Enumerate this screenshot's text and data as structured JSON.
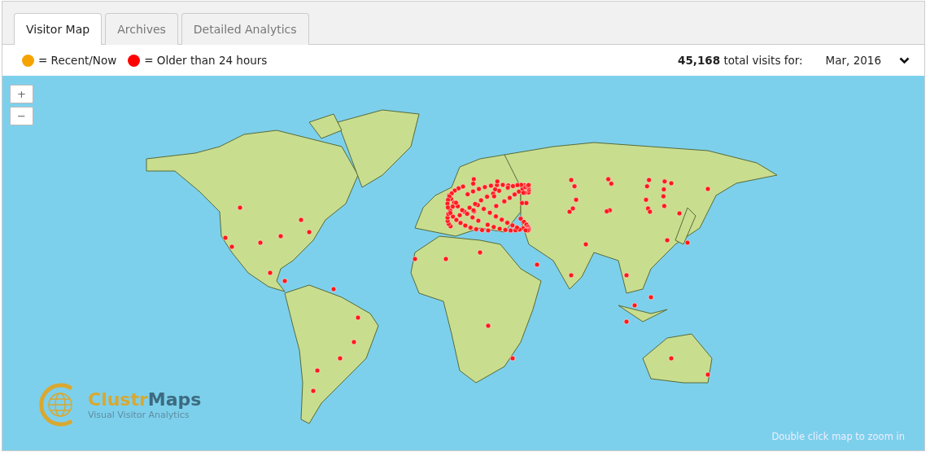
{
  "tabs": [
    {
      "label": "Visitor Map",
      "selected": true
    },
    {
      "label": "Archives",
      "selected": false
    },
    {
      "label": "Detailed Analytics",
      "selected": false
    }
  ],
  "legend": [
    {
      "label": "= Recent/Now",
      "color": "#f5a300"
    },
    {
      "label": "= Older than 24 hours",
      "color": "#ff0000"
    }
  ],
  "total_visits": "**45,168** total visits for:",
  "period_select": {
    "value": "Mar, 2016"
  },
  "zoom_controls": [
    "+",
    "−"
  ],
  "logo": {
    "name_parts": [
      "Clustr",
      "Maps"
    ],
    "tagline": "Visual Visitor Analytics"
  },
  "map_hint": "Double click map to zoom in"
}
